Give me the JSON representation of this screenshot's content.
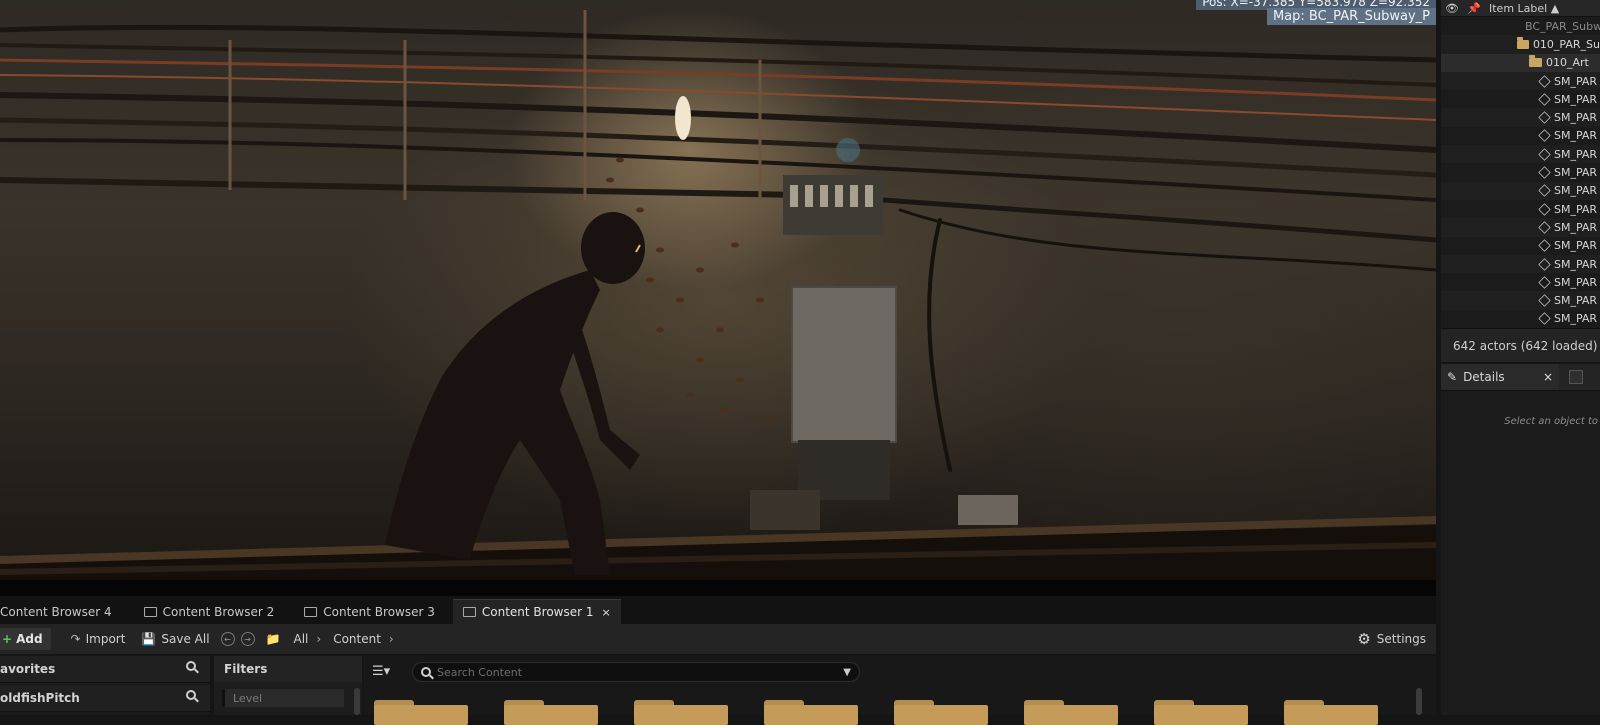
{
  "viewport": {
    "pos_readout": "Pos: X=-37.385 Y=583.978 Z=92.352",
    "map_label": "Map: BC_PAR_Subway_P"
  },
  "outliner": {
    "header_label": "Item Label ▲",
    "rows": [
      {
        "label": "BC_PAR_Subw",
        "type": "level",
        "indent": 80
      },
      {
        "label": "010_PAR_Su",
        "type": "folder",
        "indent": 76
      },
      {
        "label": "010_Art",
        "type": "folder",
        "indent": 88
      },
      {
        "label": "SM_PAR",
        "type": "mesh",
        "indent": 98
      },
      {
        "label": "SM_PAR",
        "type": "mesh",
        "indent": 98
      },
      {
        "label": "SM_PAR",
        "type": "mesh",
        "indent": 98
      },
      {
        "label": "SM_PAR",
        "type": "mesh",
        "indent": 98
      },
      {
        "label": "SM_PAR",
        "type": "mesh",
        "indent": 98
      },
      {
        "label": "SM_PAR",
        "type": "mesh",
        "indent": 98
      },
      {
        "label": "SM_PAR",
        "type": "mesh",
        "indent": 98
      },
      {
        "label": "SM_PAR",
        "type": "mesh",
        "indent": 98
      },
      {
        "label": "SM_PAR",
        "type": "mesh",
        "indent": 98
      },
      {
        "label": "SM_PAR",
        "type": "mesh",
        "indent": 98
      },
      {
        "label": "SM_PAR",
        "type": "mesh",
        "indent": 98
      },
      {
        "label": "SM_PAR",
        "type": "mesh",
        "indent": 98
      },
      {
        "label": "SM_PAR",
        "type": "mesh",
        "indent": 98
      },
      {
        "label": "SM_PAR",
        "type": "mesh",
        "indent": 98
      }
    ],
    "footer": "642 actors (642 loaded)"
  },
  "details": {
    "tab_label": "Details",
    "close_glyph": "×",
    "empty_text": "Select an object to"
  },
  "content_browser": {
    "tabs": [
      {
        "label": "Content Browser 4",
        "active": false
      },
      {
        "label": "Content Browser 2",
        "active": false
      },
      {
        "label": "Content Browser 3",
        "active": false
      },
      {
        "label": "Content Browser 1",
        "active": true
      }
    ],
    "tab_close_glyph": "×",
    "toolbar": {
      "add_label": "Add",
      "import_label": "Import",
      "save_all_label": "Save All",
      "crumb_all": "All",
      "crumb_content": "Content",
      "settings_label": "Settings"
    },
    "left_panel": {
      "favorites_label": "avorites",
      "project_label": "oldfishPitch"
    },
    "filters": {
      "title": "Filters",
      "level_chip": "Level"
    },
    "search": {
      "placeholder": "Search Content"
    }
  },
  "colors": {
    "accent_add": "#5fc25f",
    "folder": "#c49b58",
    "overlay_bg": "#5f7184"
  }
}
